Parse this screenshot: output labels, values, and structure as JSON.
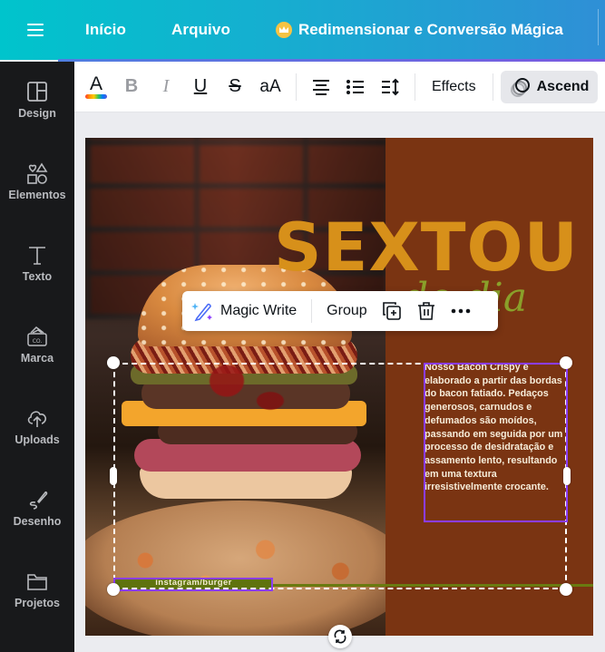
{
  "topbar": {
    "menu_icon": "hamburger-menu-icon",
    "nav": [
      "Início",
      "Arquivo"
    ],
    "magic_resize": "Redimensionar e Conversão Mágica",
    "magic_resize_icon": "crown-icon"
  },
  "sidebar": {
    "items": [
      {
        "label": "Design",
        "icon": "layout-icon"
      },
      {
        "label": "Elementos",
        "icon": "shapes-icon"
      },
      {
        "label": "Texto",
        "icon": "text-icon"
      },
      {
        "label": "Marca",
        "icon": "brand-icon"
      },
      {
        "label": "Uploads",
        "icon": "cloud-upload-icon"
      },
      {
        "label": "Desenho",
        "icon": "draw-icon"
      },
      {
        "label": "Projetos",
        "icon": "folder-icon"
      }
    ]
  },
  "toolbar": {
    "text_color": "A",
    "bold": "B",
    "italic": "I",
    "underline": "U",
    "strikethrough": "S",
    "case": "aA",
    "effects": "Effects",
    "animation": "Ascend"
  },
  "context_toolbar": {
    "magic_write": "Magic Write",
    "group": "Group",
    "duplicate_icon": "duplicate-icon",
    "delete_icon": "trash-icon",
    "more_icon": "more-icon"
  },
  "design": {
    "headline": "SEXTOU",
    "subheadline": "do dia",
    "description": "Nosso Bacon Crispy é elaborado a partir das bordas do bacon fatiado. Pedaços generosos, carnudos e defumados são moídos, passando em seguida por um processo de desidratação e assamento lento, resultando em uma textura irresistivelmente crocante.",
    "instagram": "instagram/burger",
    "colors": {
      "panel": "#7a3412",
      "headline": "#d7901a",
      "subheadline": "#8aa02a",
      "selection": "#8b3dff"
    }
  }
}
